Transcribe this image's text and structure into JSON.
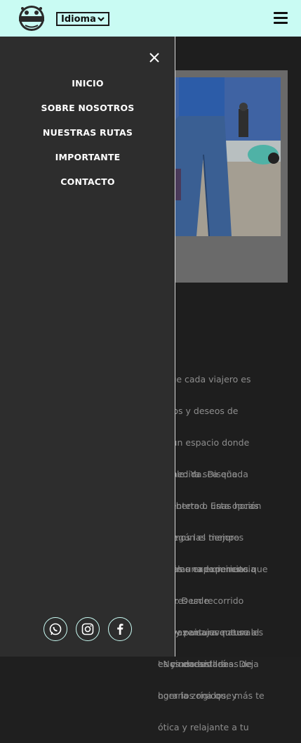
{
  "header": {
    "language_select": {
      "selected": "Idioma"
    },
    "menu_icon": "hamburger-icon",
    "logo_icon": "vespa-scooter-logo"
  },
  "drawer": {
    "close_icon": "close-icon",
    "nav_items": [
      {
        "label": "INICIO"
      },
      {
        "label": "SOBRE NOSOTROS"
      },
      {
        "label": "NUESTRAS RUTAS"
      },
      {
        "label": "IMPORTANTE"
      },
      {
        "label": "CONTACTO"
      }
    ],
    "social": [
      {
        "icon": "whatsapp-icon"
      },
      {
        "icon": "instagram-icon"
      },
      {
        "icon": "facebook-icon"
      }
    ]
  },
  "background_text": {
    "block1": [
      "s que cada viajero es",
      "rarios y deseos de",
      "do un espacio donde",
      " a medida. Diseñada",
      "j y libertad. Esta opción",
      "al según el tiempo",
      "ar y las experiencias que"
    ],
    "block2": [
      "onible: Ya sea que",
      "lía entero o unas horas",
      "aremos las mejores",
      "náximo cada minuto.",
      "orar: Desde",
      "cos y paisajes naturales",
      "es ciudades llenas de",
      "oger la zona que más te"
    ],
    "block3": [
      "uscas una experiencia",
      "efieres un recorrido",
      "tal vez una aventura al",
      "' Nos encantará"
    ],
    "block4": [
      "una aventura que se",
      "es y necesidades. Deja",
      "horarios rígidos, y",
      "ótica y relajante a tu"
    ]
  },
  "colors": {
    "header_bg": "#c9fbf3",
    "drawer_bg": "#2d2d2d",
    "accent": "#c9fbf3"
  }
}
